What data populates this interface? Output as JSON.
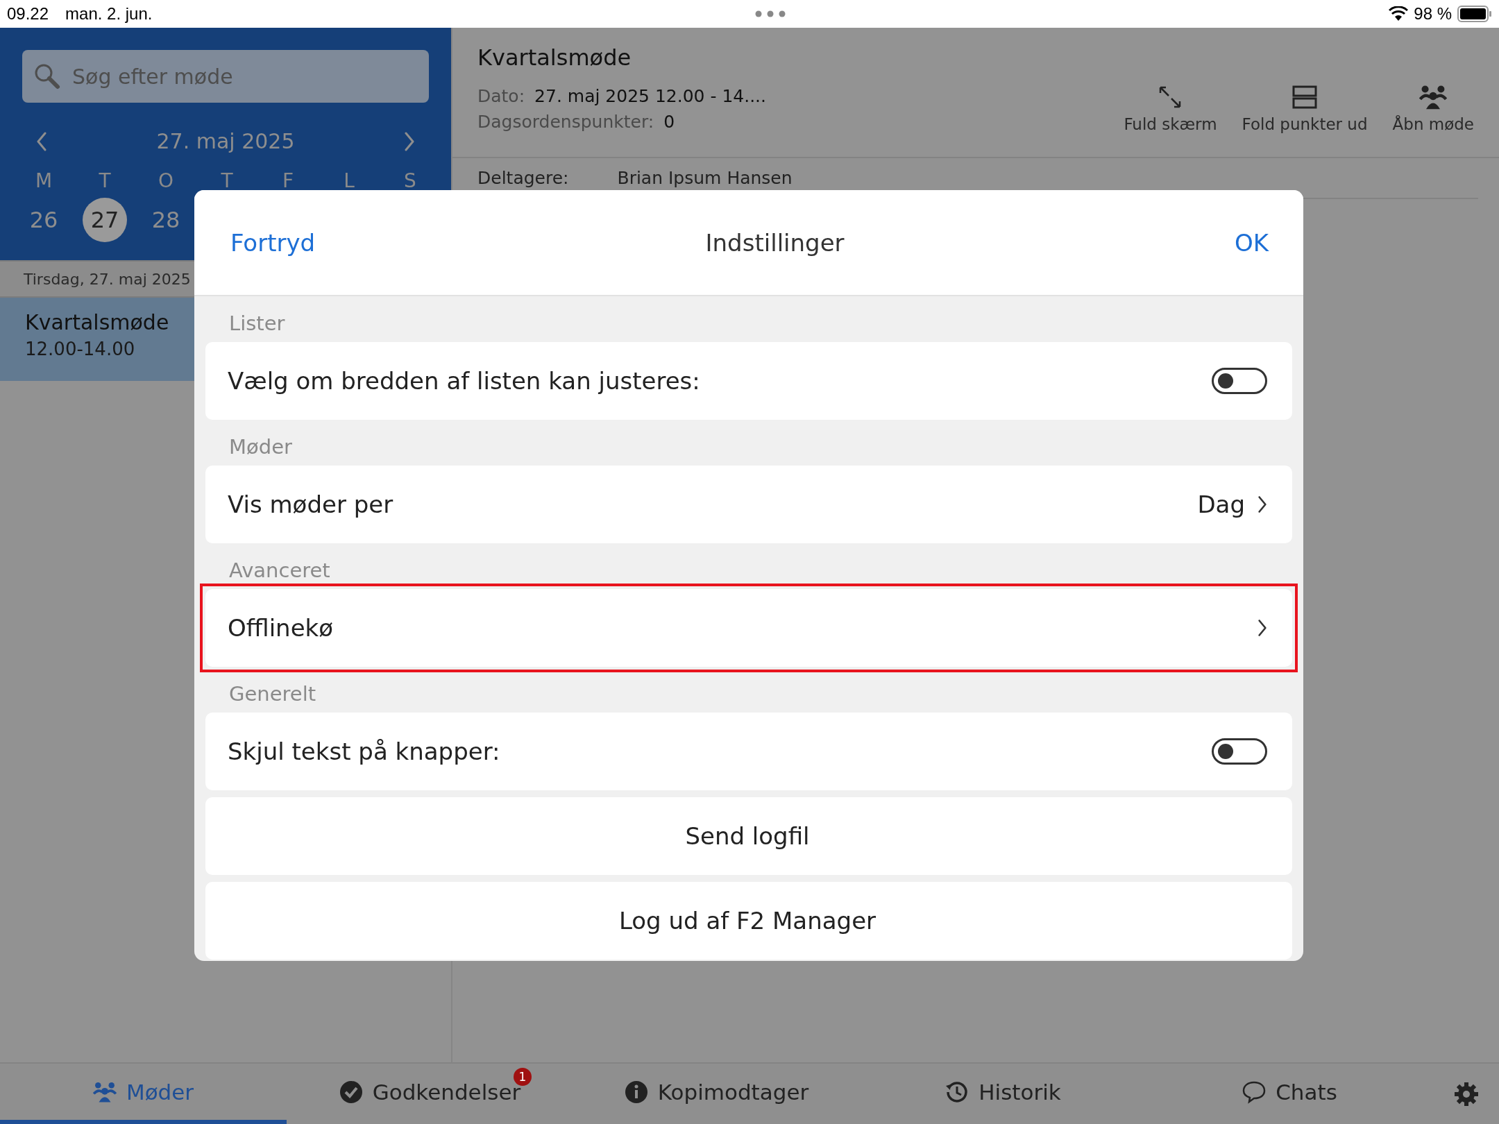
{
  "status_bar": {
    "time": "09.22",
    "date": "man. 2. jun.",
    "battery": "98 %"
  },
  "sidebar": {
    "search": {
      "placeholder": "Søg efter møde"
    },
    "month": "27. maj 2025",
    "weekdays": [
      "M",
      "T",
      "O",
      "T",
      "F",
      "L",
      "S"
    ],
    "days": [
      {
        "label": "26",
        "selected": false
      },
      {
        "label": "27",
        "selected": true
      },
      {
        "label": "28",
        "selected": false
      }
    ],
    "date_header": "Tirsdag, 27. maj 2025",
    "meetings": [
      {
        "title": "Kvartalsmøde",
        "time": "12.00-14.00",
        "selected": true
      }
    ]
  },
  "meeting": {
    "title": "Kvartalsmøde",
    "fields": [
      {
        "label": "Dato:",
        "value": "27. maj 2025 12.00 - 14...."
      },
      {
        "label": "Dagsordenspunkter:",
        "value": "0"
      }
    ],
    "actions": [
      {
        "label": "Fuld skærm",
        "kind": "fullscreen"
      },
      {
        "label": "Fold punkter ud",
        "kind": "expand"
      },
      {
        "label": "Åbn møde",
        "kind": "open"
      }
    ],
    "participants": {
      "label": "Deltagere:",
      "value": "Brian Ipsum Hansen"
    }
  },
  "dialog": {
    "cancel": "Fortryd",
    "title": "Indstillinger",
    "confirm": "OK",
    "sections": [
      {
        "header": "Lister",
        "rows": [
          {
            "kind": "toggle",
            "label": "Vælg om bredden af listen kan justeres:",
            "on": false
          }
        ]
      },
      {
        "header": "Møder",
        "rows": [
          {
            "kind": "value",
            "label": "Vis møder per",
            "value": "Dag"
          }
        ]
      },
      {
        "header": "Avanceret",
        "rows": [
          {
            "kind": "link",
            "label": "Offlinekø",
            "highlighted": true
          }
        ]
      },
      {
        "header": "Generelt",
        "rows": [
          {
            "kind": "toggle",
            "label": "Skjul tekst på knapper:",
            "on": false
          },
          {
            "kind": "button",
            "label": "Send logfil"
          },
          {
            "kind": "button",
            "label": "Log ud af F2 Manager"
          }
        ]
      }
    ]
  },
  "tab_bar": {
    "tabs": [
      {
        "label": "Møder",
        "kind": "people",
        "selected": true
      },
      {
        "label": "Godkendelser",
        "kind": "check",
        "selected": false,
        "badge": "1"
      },
      {
        "label": "Kopimodtager",
        "kind": "info",
        "selected": false
      },
      {
        "label": "Historik",
        "kind": "history",
        "selected": false
      },
      {
        "label": "Chats",
        "kind": "chat",
        "selected": false
      }
    ]
  }
}
